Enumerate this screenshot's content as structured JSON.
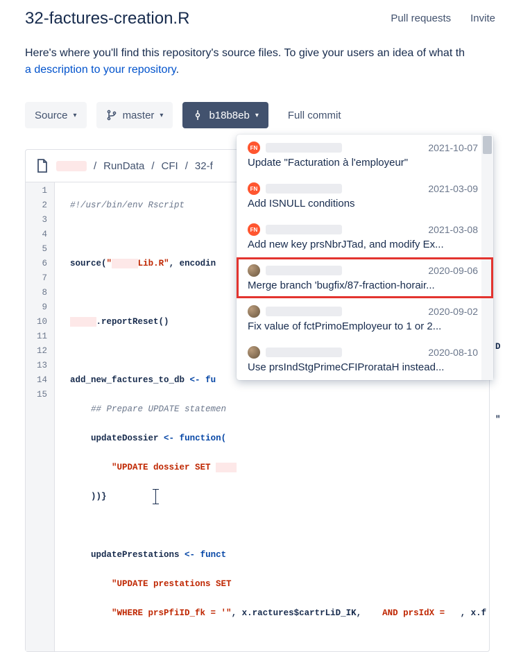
{
  "header": {
    "title": "32-factures-creation.R",
    "pull_requests": "Pull requests",
    "invite": "Invite"
  },
  "description": {
    "text_before": "Here's where you'll find this repository's source files. To give your users an idea of what th",
    "link": "a description to your repository",
    "period": "."
  },
  "toolbar": {
    "source": "Source",
    "branch": "master",
    "commit_hash": "b18b8eb",
    "full_commit": "Full commit"
  },
  "breadcrumb": {
    "seg0": "RunData",
    "seg1": "CFI",
    "seg2": "32-f",
    "sep": "/"
  },
  "code": {
    "lines": [
      {
        "n": 1,
        "type": "comment",
        "t": "#!/usr/bin/env Rscript"
      },
      {
        "n": 2,
        "type": "blank"
      },
      {
        "n": 3,
        "type": "src_lib"
      },
      {
        "n": 4,
        "type": "blank"
      },
      {
        "n": 5,
        "type": "report_reset"
      },
      {
        "n": 6,
        "type": "blank"
      },
      {
        "n": 7,
        "type": "add_new"
      },
      {
        "n": 8,
        "type": "prepare_comment"
      },
      {
        "n": 9,
        "type": "update_dossier"
      },
      {
        "n": 10,
        "type": "update_str"
      },
      {
        "n": 11,
        "type": "close_brace"
      },
      {
        "n": 12,
        "type": "blank"
      },
      {
        "n": 13,
        "type": "update_prest"
      },
      {
        "n": 14,
        "type": "update_prest_str"
      },
      {
        "n": 15,
        "type": "where_str"
      }
    ],
    "s_source": "source(",
    "s_lib": "Lib.R",
    "s_enc": ", encodin",
    "s_report": ".reportReset()",
    "s_addnew": "add_new_factures_to_db ",
    "s_arrow": "<-",
    "s_fu": " fu",
    "s_prepcmt": "    ## Prepare UPDATE statemen",
    "s_upd_dossier_a": "    updateDossier ",
    "s_func_paren": " function(",
    "s_upd_str": "        \"UPDATE dossier SET ",
    "s_closebr": "    ))}",
    "s_upd_prest_a": "    updatePrestations ",
    "s_funct": " funct",
    "s_upd_prest_str": "        \"UPDATE prestations SET ",
    "s_where_a": "        \"WHERE prsPfiID_fk = '\"",
    "s_where_b": ", x.ractures$cartr",
    "s_where_c": "LiD_IK",
    "s_where_d": ",    ",
    "s_and": "AND prsIdX =",
    "s_where_e": "   , x.f",
    "last_col1": "D",
    "last_col_quote": "\""
  },
  "commits": [
    {
      "avatar": "FN",
      "avatar_type": "initials",
      "date": "2021-10-07",
      "msg": "Update \"Facturation à l'employeur\""
    },
    {
      "avatar": "FN",
      "avatar_type": "initials",
      "date": "2021-03-09",
      "msg": "Add ISNULL conditions"
    },
    {
      "avatar": "FN",
      "avatar_type": "initials",
      "date": "2021-03-08",
      "msg": "Add new key prsNbrJTad, and modify Ex..."
    },
    {
      "avatar": "",
      "avatar_type": "photo",
      "date": "2020-09-06",
      "msg": "Merge branch 'bugfix/87-fraction-horair...",
      "highlight": true
    },
    {
      "avatar": "",
      "avatar_type": "photo",
      "date": "2020-09-02",
      "msg": "Fix value of fctPrimoEmployeur to 1 or 2..."
    },
    {
      "avatar": "",
      "avatar_type": "photo",
      "date": "2020-08-10",
      "msg": "Use prsIndStgPrimeCFIProrataH instead..."
    }
  ]
}
